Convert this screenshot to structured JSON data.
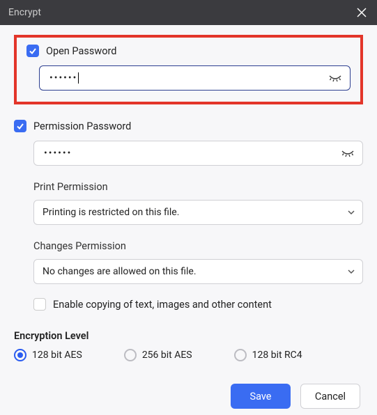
{
  "window": {
    "title": "Encrypt"
  },
  "openPassword": {
    "label": "Open Password",
    "checked": true,
    "value": "••••••"
  },
  "permissionPassword": {
    "label": "Permission Password",
    "checked": true,
    "value": "••••••"
  },
  "printPermission": {
    "label": "Print Permission",
    "value": "Printing is restricted on this file."
  },
  "changesPermission": {
    "label": "Changes Permission",
    "value": "No changes are allowed on this file."
  },
  "enableCopy": {
    "label": "Enable copying of text, images and other content",
    "checked": false
  },
  "encryption": {
    "title": "Encryption Level",
    "options": {
      "aes128": "128 bit AES",
      "aes256": "256 bit AES",
      "rc4128": "128 bit RC4"
    },
    "selected": "aes128"
  },
  "buttons": {
    "save": "Save",
    "cancel": "Cancel"
  }
}
